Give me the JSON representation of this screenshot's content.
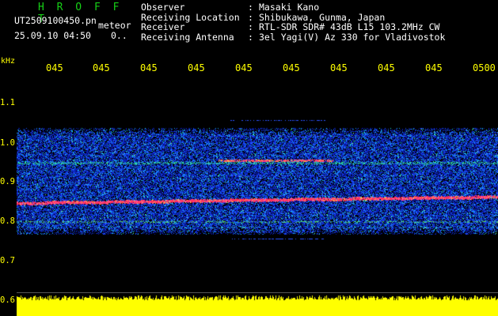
{
  "header": {
    "brand": "H R O F F T",
    "filename": "UT2509100450.pn",
    "mode": "meteor",
    "datetime": "25.09.10 04:50",
    "datetime_extra": "0..",
    "info": [
      {
        "label": "Observer",
        "value": "Masaki Kano"
      },
      {
        "label": "Receiving Location",
        "value": "Shibukawa, Gunma, Japan"
      },
      {
        "label": "Receiver",
        "value": "RTL-SDR SDR# 43dB L15 103.2MHz CW"
      },
      {
        "label": "Receiving Antenna",
        "value": "3el Yagi(V) Az 330 for Vladivostok"
      }
    ]
  },
  "axes": {
    "unit": "kHz",
    "time_labels": [
      "045",
      "045",
      "045",
      "045",
      "045",
      "045",
      "045",
      "045",
      "045",
      "0500"
    ],
    "freq_labels": [
      "1.1",
      "1.0",
      "0.9",
      "0.8",
      "0.7",
      "0.6"
    ]
  },
  "colors": {
    "background": "#000000",
    "label_yellow": "#ffff00",
    "brand_green": "#16d016",
    "signal_red": "#ff3060",
    "noise_blue": "#1030ff",
    "power_yellow": "#ffff00"
  }
}
